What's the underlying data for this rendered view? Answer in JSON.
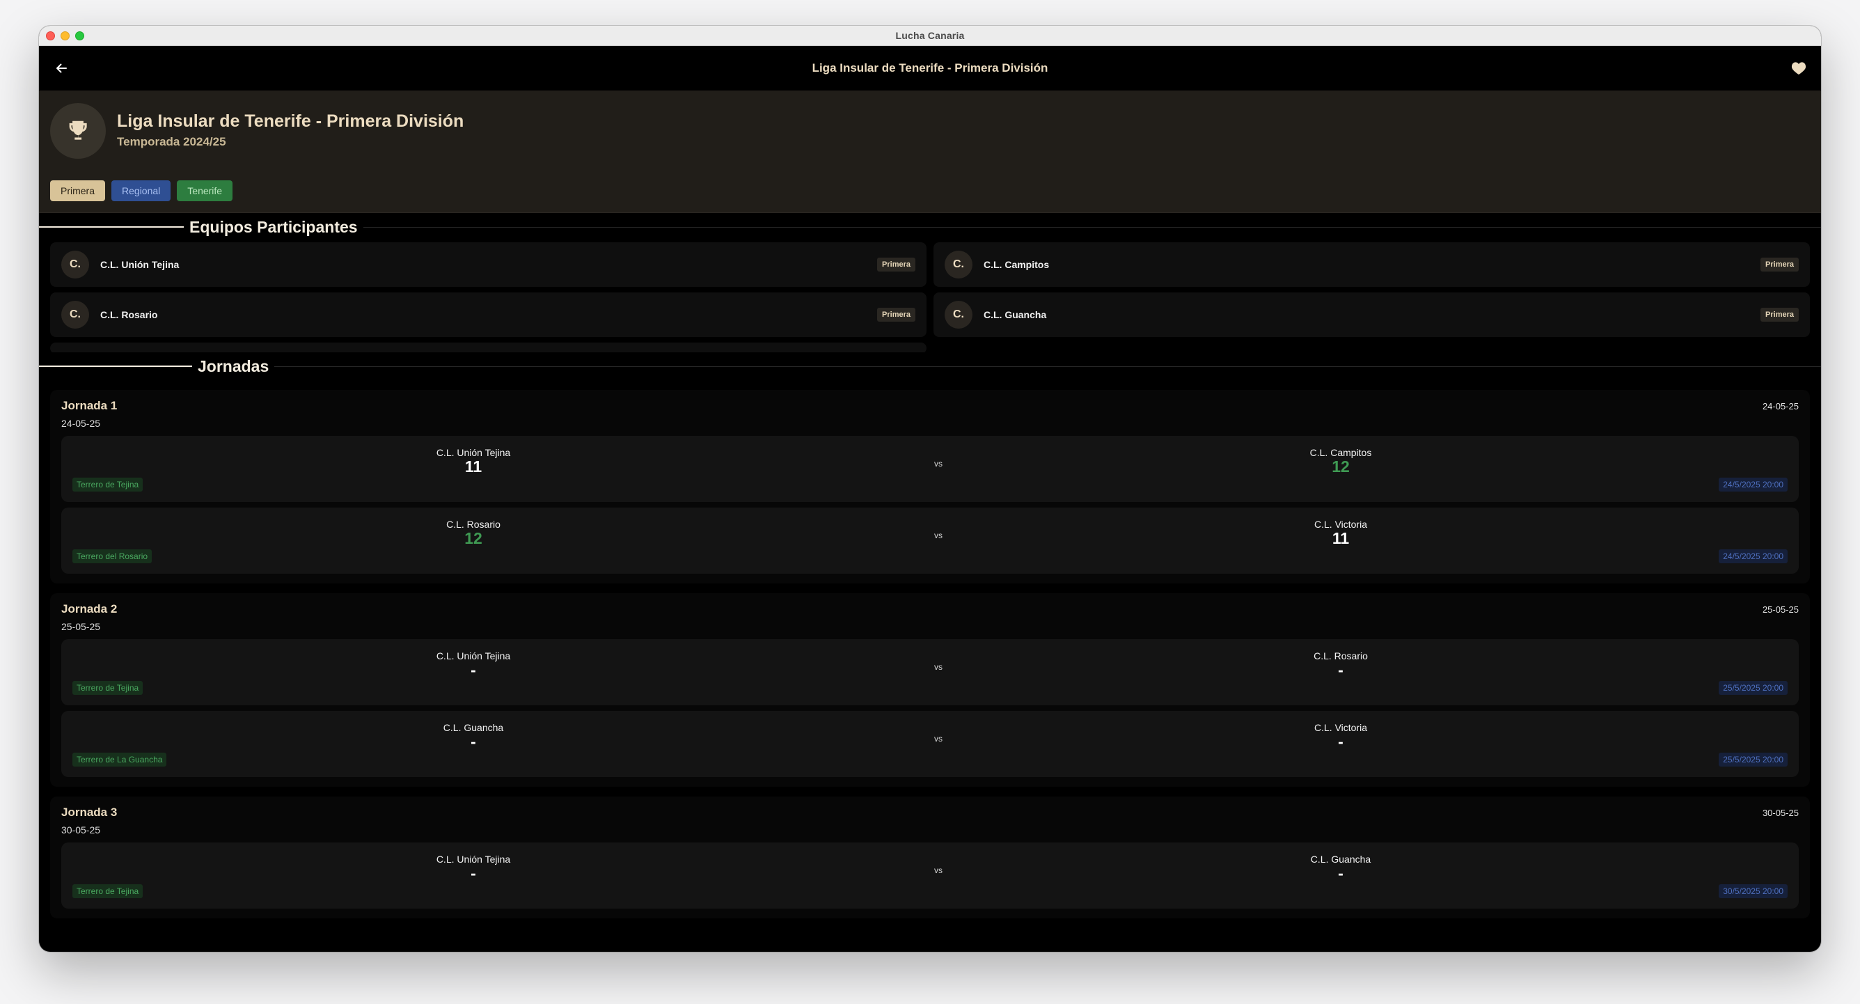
{
  "window": {
    "title": "Lucha Canaria"
  },
  "appbar": {
    "title": "Liga Insular de Tenerife - Primera División"
  },
  "league": {
    "name": "Liga Insular de Tenerife - Primera División",
    "season": "Temporada 2024/25",
    "chips": [
      "Primera",
      "Regional",
      "Tenerife"
    ]
  },
  "sections": {
    "teams": "Equipos Participantes",
    "jornadas": "Jornadas"
  },
  "teams": [
    {
      "initial": "C.",
      "name": "C.L. Unión Tejina",
      "badge": "Primera"
    },
    {
      "initial": "C.",
      "name": "C.L. Campitos",
      "badge": "Primera"
    },
    {
      "initial": "C.",
      "name": "C.L. Rosario",
      "badge": "Primera"
    },
    {
      "initial": "C.",
      "name": "C.L. Guancha",
      "badge": "Primera"
    }
  ],
  "jornadas": [
    {
      "name": "Jornada 1",
      "date": "24-05-25",
      "date_right": "24-05-25",
      "matches": [
        {
          "home": "C.L. Unión Tejina",
          "home_score": "11",
          "away": "C.L. Campitos",
          "away_score": "12",
          "vs": "vs",
          "venue": "Terrero de Tejina",
          "datetime": "24/5/2025 20:00"
        },
        {
          "home": "C.L. Rosario",
          "home_score": "12",
          "away": "C.L. Victoria",
          "away_score": "11",
          "vs": "vs",
          "venue": "Terrero del Rosario",
          "datetime": "24/5/2025 20:00"
        }
      ]
    },
    {
      "name": "Jornada 2",
      "date": "25-05-25",
      "date_right": "25-05-25",
      "matches": [
        {
          "home": "C.L. Unión Tejina",
          "home_score": "-",
          "away": "C.L. Rosario",
          "away_score": "-",
          "vs": "vs",
          "venue": "Terrero de Tejina",
          "datetime": "25/5/2025 20:00"
        },
        {
          "home": "C.L. Guancha",
          "home_score": "-",
          "away": "C.L. Victoria",
          "away_score": "-",
          "vs": "vs",
          "venue": "Terrero de La Guancha",
          "datetime": "25/5/2025 20:00"
        }
      ]
    },
    {
      "name": "Jornada 3",
      "date": "30-05-25",
      "date_right": "30-05-25",
      "matches": [
        {
          "home": "C.L. Unión Tejina",
          "home_score": "-",
          "away": "C.L. Guancha",
          "away_score": "-",
          "vs": "vs",
          "venue": "Terrero de Tejina",
          "datetime": "30/5/2025 20:00"
        }
      ]
    }
  ]
}
